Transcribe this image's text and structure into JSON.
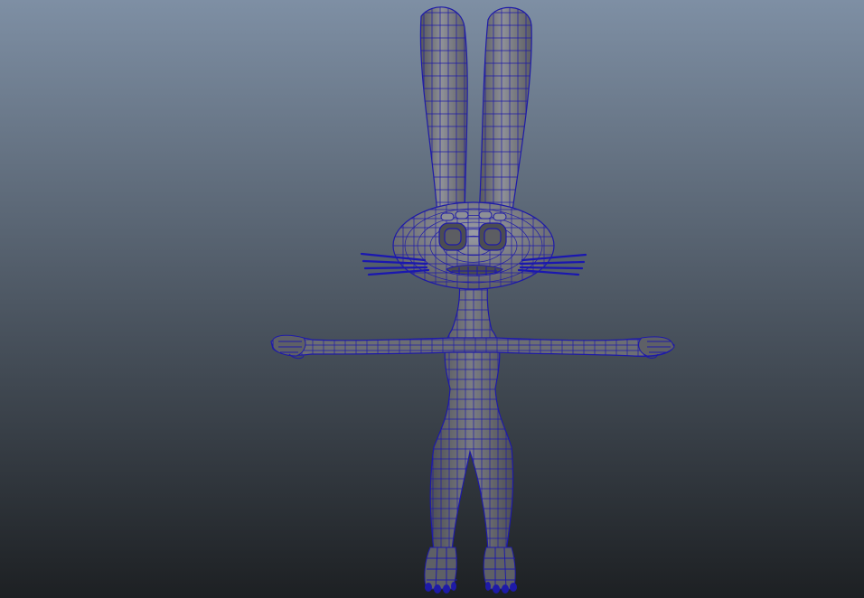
{
  "viewport": {
    "background_top": "#7e8fa4",
    "background_bottom": "#1d2023"
  },
  "model": {
    "surface_color": "#6a6b70",
    "surface_light": "#9a9ca4",
    "wireframe_color": "#1e1aa8"
  }
}
